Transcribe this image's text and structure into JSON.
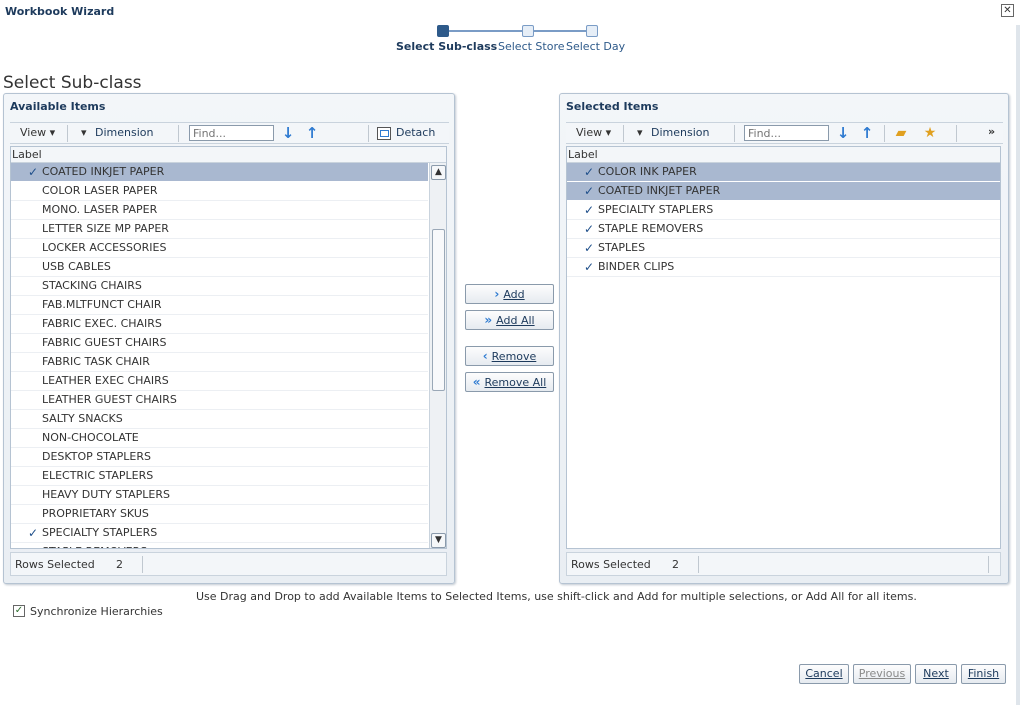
{
  "window": {
    "title": "Workbook Wizard",
    "close_symbol": "✕"
  },
  "train": {
    "steps": [
      {
        "label": "Select Sub-class",
        "active": true
      },
      {
        "label": "Select Store",
        "active": false
      },
      {
        "label": "Select Day",
        "active": false
      }
    ]
  },
  "page": {
    "title": "Select Sub-class"
  },
  "available": {
    "header": "Available Items",
    "toolbar": {
      "view": "View",
      "dimension": "Dimension",
      "find_placeholder": "Find...",
      "detach": "Detach"
    },
    "column_label": "Label",
    "rows": [
      {
        "label": "COATED INKJET PAPER",
        "checked": true,
        "selected": true
      },
      {
        "label": "COLOR LASER PAPER",
        "checked": false,
        "selected": false
      },
      {
        "label": "MONO. LASER PAPER",
        "checked": false,
        "selected": false
      },
      {
        "label": "LETTER SIZE MP PAPER",
        "checked": false,
        "selected": false
      },
      {
        "label": "LOCKER ACCESSORIES",
        "checked": false,
        "selected": false
      },
      {
        "label": "USB CABLES",
        "checked": false,
        "selected": false
      },
      {
        "label": "STACKING CHAIRS",
        "checked": false,
        "selected": false
      },
      {
        "label": "FAB.MLTFUNCT CHAIR",
        "checked": false,
        "selected": false
      },
      {
        "label": "FABRIC EXEC. CHAIRS",
        "checked": false,
        "selected": false
      },
      {
        "label": "FABRIC GUEST CHAIRS",
        "checked": false,
        "selected": false
      },
      {
        "label": "FABRIC TASK CHAIR",
        "checked": false,
        "selected": false
      },
      {
        "label": "LEATHER EXEC CHAIRS",
        "checked": false,
        "selected": false
      },
      {
        "label": "LEATHER GUEST CHAIRS",
        "checked": false,
        "selected": false
      },
      {
        "label": "SALTY SNACKS",
        "checked": false,
        "selected": false
      },
      {
        "label": "NON-CHOCOLATE",
        "checked": false,
        "selected": false
      },
      {
        "label": "DESKTOP STAPLERS",
        "checked": false,
        "selected": false
      },
      {
        "label": "ELECTRIC STAPLERS",
        "checked": false,
        "selected": false
      },
      {
        "label": "HEAVY DUTY STAPLERS",
        "checked": false,
        "selected": false
      },
      {
        "label": "PROPRIETARY SKUS",
        "checked": false,
        "selected": false
      },
      {
        "label": "SPECIALTY STAPLERS",
        "checked": true,
        "selected": false
      },
      {
        "label": "STAPLE REMOVERS",
        "checked": true,
        "selected": false
      }
    ],
    "footer_label": "Rows Selected",
    "footer_count": "2"
  },
  "selected": {
    "header": "Selected Items",
    "toolbar": {
      "view": "View",
      "dimension": "Dimension",
      "find_placeholder": "Find...",
      "more": "»"
    },
    "column_label": "Label",
    "rows": [
      {
        "label": "COLOR INK PAPER",
        "checked": true,
        "selected": true
      },
      {
        "label": "COATED INKJET PAPER",
        "checked": true,
        "selected": true
      },
      {
        "label": "SPECIALTY STAPLERS",
        "checked": true,
        "selected": false
      },
      {
        "label": "STAPLE REMOVERS",
        "checked": true,
        "selected": false
      },
      {
        "label": "STAPLES",
        "checked": true,
        "selected": false
      },
      {
        "label": "BINDER CLIPS",
        "checked": true,
        "selected": false
      }
    ],
    "footer_label": "Rows Selected",
    "footer_count": "2"
  },
  "shuttle": {
    "add": "Add",
    "add_all": "Add All",
    "remove": "Remove",
    "remove_all": "Remove All"
  },
  "hint": "Use Drag and Drop to add Available Items to Selected Items, use shift-click and Add for multiple selections, or Add All for all items.",
  "sync": {
    "label": "Synchronize Hierarchies",
    "checked": true
  },
  "nav": {
    "cancel": "Cancel",
    "previous": "Previous",
    "next": "Next",
    "finish": "Finish"
  },
  "colors": {
    "selection": "#a9b8d0",
    "accent": "#2f7bd1",
    "header_text": "#1d3a5c"
  },
  "icons": {
    "check": "checkmark-icon",
    "down": "arrow-down-icon",
    "up": "arrow-up-icon"
  }
}
